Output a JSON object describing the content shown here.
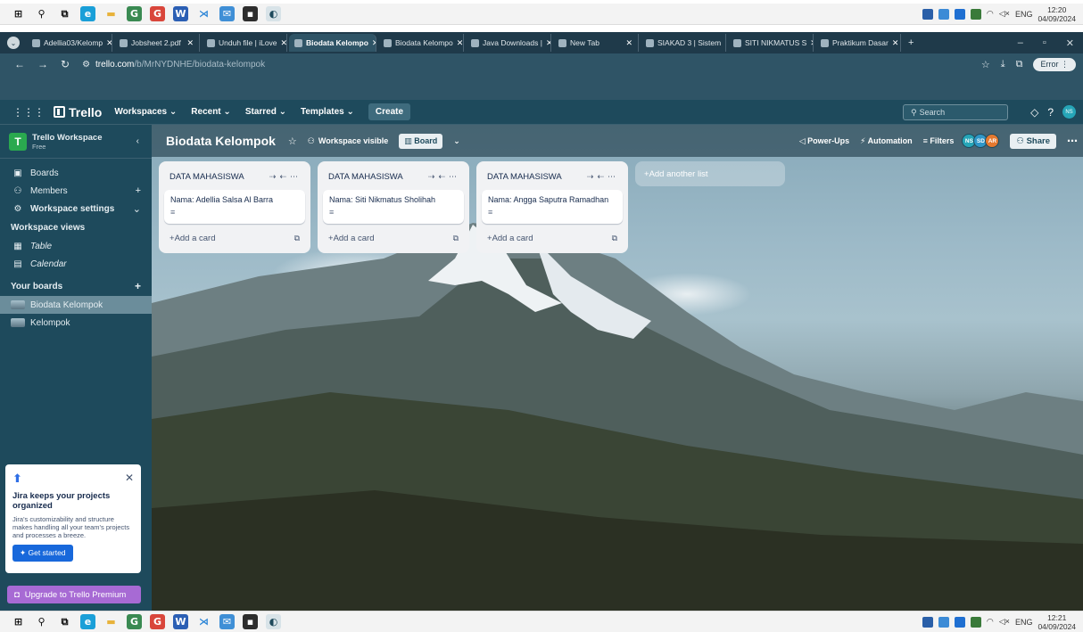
{
  "taskbar": {
    "apps": [
      {
        "name": "windows-start-icon",
        "glyph": "⊞",
        "color": "#0a0a0a",
        "bg": "transparent"
      },
      {
        "name": "search-icon",
        "glyph": "⚲",
        "color": "#0a0a0a",
        "bg": "transparent"
      },
      {
        "name": "task-view-icon",
        "glyph": "⧉",
        "color": "#0a0a0a",
        "bg": "transparent"
      },
      {
        "name": "edge-icon",
        "glyph": "e",
        "color": "#ffffff",
        "bg": "#1a9fd8"
      },
      {
        "name": "file-explorer-icon",
        "glyph": "▬",
        "color": "#e8b23a",
        "bg": "transparent"
      },
      {
        "name": "chrome-icon",
        "glyph": "G",
        "color": "#ffffff",
        "bg": "#3a8a52"
      },
      {
        "name": "chrome-profile-icon",
        "glyph": "G",
        "color": "#ffffff",
        "bg": "#d9463b"
      },
      {
        "name": "word-icon",
        "glyph": "W",
        "color": "#ffffff",
        "bg": "#2b5fb4"
      },
      {
        "name": "vscode-icon",
        "glyph": "⋊",
        "color": "#2a84d6",
        "bg": "transparent"
      },
      {
        "name": "mail-icon",
        "glyph": "✉",
        "color": "#ffffff",
        "bg": "#3f8fd6"
      },
      {
        "name": "terminal-icon",
        "glyph": "▪",
        "color": "#ffffff",
        "bg": "#2d2d2d"
      },
      {
        "name": "paint-icon",
        "glyph": "◐",
        "color": "#1e4a5c",
        "bg": "#d8e3e8"
      }
    ],
    "tray_lang": "ENG",
    "top_time": "12:20",
    "top_date": "04/09/2024",
    "bottom_time": "12:21",
    "bottom_date": "04/09/2024"
  },
  "browser": {
    "tabs": [
      {
        "label": "Adellia03/Kelomp",
        "active": false
      },
      {
        "label": "Jobsheet 2.pdf",
        "active": false
      },
      {
        "label": "Unduh file | iLove",
        "active": false
      },
      {
        "label": "Biodata Kelompo",
        "active": true
      },
      {
        "label": "Biodata Kelompo",
        "active": false
      },
      {
        "label": "Java Downloads |",
        "active": false
      },
      {
        "label": "New Tab",
        "active": false
      },
      {
        "label": "SIAKAD 3 | Sistem",
        "active": false
      },
      {
        "label": "SITI NIKMATUS S",
        "active": false
      },
      {
        "label": "Praktikum Dasar",
        "active": false
      }
    ],
    "new_tab": "+",
    "url_host": "trello.com",
    "url_path": "/b/MrNYDNHE/biodata-kelompok",
    "error_label": "Error"
  },
  "header": {
    "logo": "Trello",
    "nav": [
      "Workspaces",
      "Recent",
      "Starred",
      "Templates"
    ],
    "create": "Create",
    "search_placeholder": "Search"
  },
  "sidebar": {
    "workspace_name": "Trello Workspace",
    "workspace_plan": "Free",
    "items": [
      {
        "label": "Boards",
        "icon": "board-icon"
      },
      {
        "label": "Members",
        "icon": "members-icon"
      },
      {
        "label": "Workspace settings",
        "icon": "gear-icon"
      }
    ],
    "views_heading": "Workspace views",
    "views": [
      {
        "label": "Table",
        "icon": "table-icon"
      },
      {
        "label": "Calendar",
        "icon": "calendar-icon"
      }
    ],
    "boards_heading": "Your boards",
    "boards": [
      {
        "label": "Biodata Kelompok",
        "active": true
      },
      {
        "label": "Kelompok",
        "active": false
      }
    ],
    "jira": {
      "title": "Jira keeps your projects organized",
      "body": "Jira's customizability and structure makes handling all your team's projects and processes a breeze.",
      "button": "Get started"
    },
    "upgrade": "Upgrade to Trello Premium"
  },
  "board": {
    "title": "Biodata Kelompok",
    "visibility": "Workspace visible",
    "view": "Board",
    "powerups": "Power-Ups",
    "automation": "Automation",
    "filters": "Filters",
    "members": [
      {
        "initials": "NS",
        "color": "#26a6b8"
      },
      {
        "initials": "SD",
        "color": "#2f97c8"
      },
      {
        "initials": "AR",
        "color": "#e5792f"
      }
    ],
    "share": "Share",
    "lists": [
      {
        "title": "DATA MAHASISWA",
        "cards": [
          {
            "title": "Nama: Adellia Salsa Al Barra"
          }
        ],
        "add_card": "Add a card"
      },
      {
        "title": "DATA MAHASISWA",
        "cards": [
          {
            "title": "Nama: Siti Nikmatus Sholihah"
          }
        ],
        "add_card": "Add a card"
      },
      {
        "title": "DATA MAHASISWA",
        "cards": [
          {
            "title": "Nama: Angga Saputra Ramadhan"
          }
        ],
        "add_card": "Add a card"
      }
    ],
    "add_list": "Add another list"
  }
}
